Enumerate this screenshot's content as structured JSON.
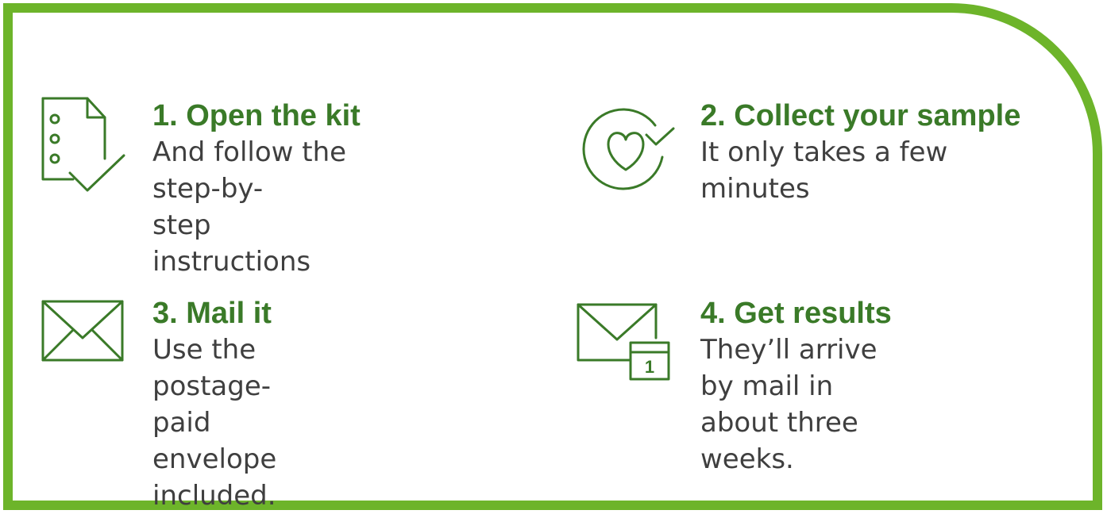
{
  "steps": [
    {
      "title": "1. Open the kit",
      "desc_lines": [
        "And follow the step-by-",
        "step instructions"
      ],
      "icon": "document-check-icon"
    },
    {
      "title": "2. Collect your sample",
      "desc_lines": [
        "It only takes a few minutes"
      ],
      "icon": "heart-refresh-icon"
    },
    {
      "title": "3. Mail it",
      "desc_lines": [
        "Use the postage-paid",
        "envelope included."
      ],
      "icon": "envelope-icon"
    },
    {
      "title": "4. Get results",
      "desc_lines": [
        "They’ll arrive by mail in",
        "about three weeks."
      ],
      "icon": "envelope-calendar-icon",
      "calendar_day": "1"
    }
  ],
  "colors": {
    "border": "#6db42a",
    "title": "#3a7a28",
    "icon": "#3a7a28",
    "text": "#3f3f3f"
  }
}
